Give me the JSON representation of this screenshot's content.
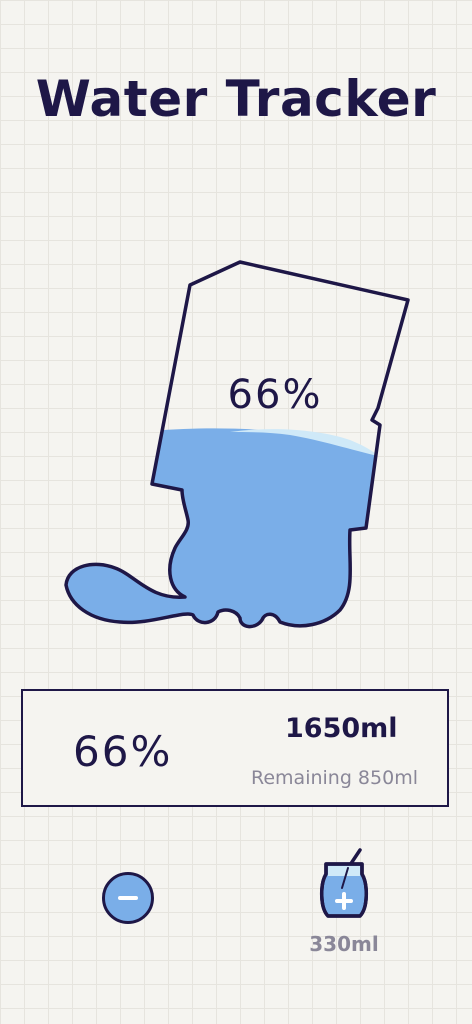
{
  "app": {
    "title": "Water Tracker"
  },
  "hero": {
    "percent_label": "66%",
    "fill_fraction": 0.66
  },
  "stats": {
    "percent": "66%",
    "amount": "1650ml",
    "remaining": "Remaining 850ml"
  },
  "controls": {
    "remove_icon": "minus-icon",
    "add_icon": "cup-plus-icon",
    "add_label": "330ml"
  },
  "colors": {
    "ink": "#1e1747",
    "water": "#7aaee8",
    "water_highlight": "#cfe9f8",
    "muted_text": "#8a8798"
  }
}
